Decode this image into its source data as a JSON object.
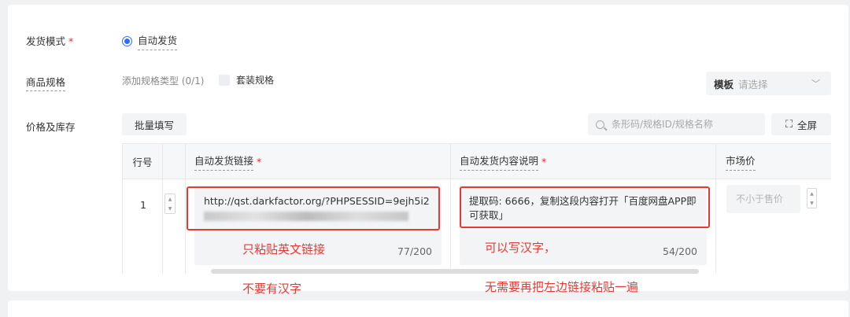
{
  "form": {
    "delivery_mode_label": "发货模式",
    "delivery_mode_required": "*",
    "delivery_mode_option": "自动发货",
    "spec_label": "商品规格",
    "spec_type_text": "添加规格类型 (0/1)",
    "spec_combo_label": "套装规格",
    "template_label": "模板",
    "template_placeholder": "请选择",
    "price_stock_label": "价格及库存",
    "batch_fill_label": "批量填写",
    "search_placeholder": "条形码/规格ID/规格名称",
    "fullscreen_label": "全屏"
  },
  "table": {
    "headers": {
      "row_no": "行号",
      "link": "自动发货链接",
      "link_required": "*",
      "desc": "自动发货内容说明",
      "desc_required": "*",
      "market_price": "市场价"
    }
  },
  "row": {
    "no": "1",
    "link_value": "http://qst.darkfactor.org/?PHPSESSID=9ejh5i2",
    "link_counter": "77/200",
    "desc_value": "提取码: 6666，复制这段内容打开「百度网盘APP即可获取」",
    "desc_counter": "54/200",
    "price_placeholder": "不小于售价"
  },
  "annotations": {
    "link_note": "只粘贴英文链接",
    "link_note2": "不要有汉字",
    "desc_note": "可以写汉字，",
    "desc_note2": "无需要再把左边链接粘贴一遍"
  },
  "colors": {
    "accent": "#2f6bff",
    "required": "#f5222d",
    "annotation": "#e53935"
  }
}
